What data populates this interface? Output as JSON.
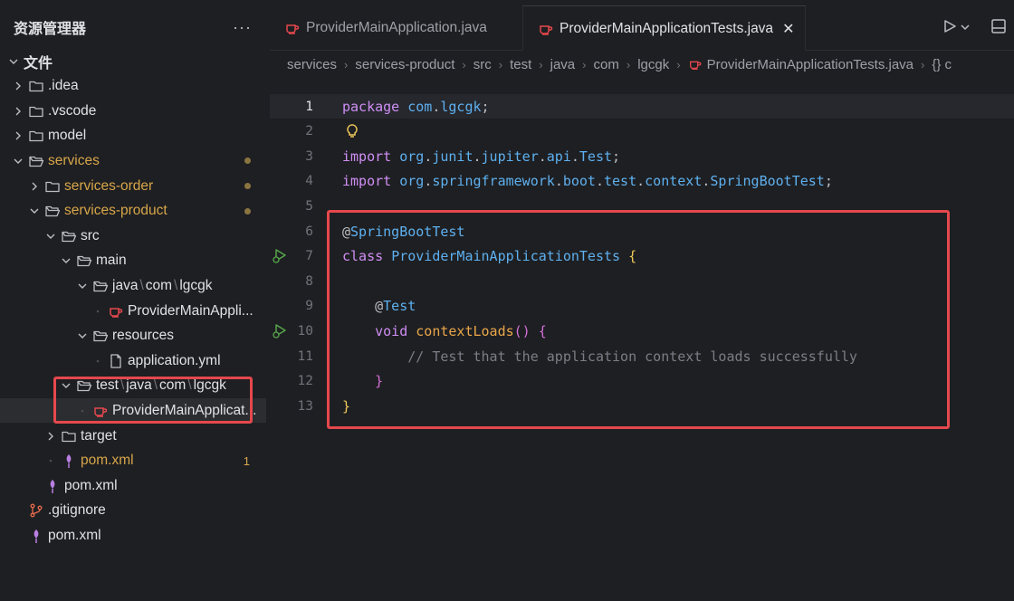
{
  "sidebar": {
    "title": "资源管理器",
    "more_icon": "ellipsis-icon",
    "rows": [
      {
        "label": "文件",
        "depth": 0,
        "kind": "root",
        "open": true
      },
      {
        "label": ".idea",
        "depth": 1,
        "kind": "folder",
        "open": false
      },
      {
        "label": ".vscode",
        "depth": 1,
        "kind": "folder",
        "open": false
      },
      {
        "label": "model",
        "depth": 1,
        "kind": "folder",
        "open": false
      },
      {
        "label": "services",
        "depth": 1,
        "kind": "folder",
        "open": true,
        "modified": true
      },
      {
        "label": "services-order",
        "depth": 2,
        "kind": "folder",
        "open": false,
        "modified": true
      },
      {
        "label": "services-product",
        "depth": 2,
        "kind": "folder",
        "open": true,
        "modified": true
      },
      {
        "label": "src",
        "depth": 3,
        "kind": "folder",
        "open": true
      },
      {
        "label": "main",
        "depth": 4,
        "kind": "folder",
        "open": true
      },
      {
        "label": [
          "java",
          "com",
          "lgcgk"
        ],
        "depth": 5,
        "kind": "folder",
        "open": true
      },
      {
        "label": "ProviderMainAppli...",
        "depth": 6,
        "kind": "java"
      },
      {
        "label": "resources",
        "depth": 5,
        "kind": "folder",
        "open": true
      },
      {
        "label": "application.yml",
        "depth": 6,
        "kind": "file"
      },
      {
        "label": [
          "test",
          "java",
          "com",
          "lgcgk"
        ],
        "depth": 4,
        "kind": "folder",
        "open": true
      },
      {
        "label": "ProviderMainApplicat...",
        "depth": 5,
        "kind": "java",
        "selected": true
      },
      {
        "label": "target",
        "depth": 3,
        "kind": "folder",
        "open": false
      },
      {
        "label": "pom.xml",
        "depth": 3,
        "kind": "maven",
        "modified": true,
        "count": "1"
      },
      {
        "label": "pom.xml",
        "depth": 2,
        "kind": "maven"
      },
      {
        "label": ".gitignore",
        "depth": 1,
        "kind": "git"
      },
      {
        "label": "pom.xml",
        "depth": 1,
        "kind": "maven"
      }
    ]
  },
  "tabs": [
    {
      "label": "ProviderMainApplication.java",
      "active": false
    },
    {
      "label": "ProviderMainApplicationTests.java",
      "active": true
    }
  ],
  "tab_close": "✕",
  "breadcrumb": [
    "services",
    "services-product",
    "src",
    "test",
    "java",
    "com",
    "lgcgk",
    "ProviderMainApplicationTests.java",
    "{} c"
  ],
  "code_lines": [
    {
      "n": "1",
      "tokens": [
        [
          "kw",
          "package"
        ],
        [
          "punc",
          " "
        ],
        [
          "ident",
          "com"
        ],
        [
          "punc",
          "."
        ],
        [
          "ident",
          "lgcgk"
        ],
        [
          "punc",
          ";"
        ]
      ]
    },
    {
      "n": "2",
      "tokens": []
    },
    {
      "n": "3",
      "tokens": [
        [
          "kw",
          "import"
        ],
        [
          "punc",
          " "
        ],
        [
          "ident",
          "org"
        ],
        [
          "punc",
          "."
        ],
        [
          "ident",
          "junit"
        ],
        [
          "punc",
          "."
        ],
        [
          "ident",
          "jupiter"
        ],
        [
          "punc",
          "."
        ],
        [
          "ident",
          "api"
        ],
        [
          "punc",
          "."
        ],
        [
          "cls",
          "Test"
        ],
        [
          "punc",
          ";"
        ]
      ]
    },
    {
      "n": "4",
      "tokens": [
        [
          "kw",
          "import"
        ],
        [
          "punc",
          " "
        ],
        [
          "ident",
          "org"
        ],
        [
          "punc",
          "."
        ],
        [
          "ident",
          "springframework"
        ],
        [
          "punc",
          "."
        ],
        [
          "ident",
          "boot"
        ],
        [
          "punc",
          "."
        ],
        [
          "ident",
          "test"
        ],
        [
          "punc",
          "."
        ],
        [
          "ident",
          "context"
        ],
        [
          "punc",
          "."
        ],
        [
          "cls",
          "SpringBootTest"
        ],
        [
          "punc",
          ";"
        ]
      ]
    },
    {
      "n": "5",
      "tokens": []
    },
    {
      "n": "6",
      "tokens": [
        [
          "punc",
          "@"
        ],
        [
          "ann",
          "SpringBootTest"
        ]
      ]
    },
    {
      "n": "7",
      "tokens": [
        [
          "kw",
          "class"
        ],
        [
          "punc",
          " "
        ],
        [
          "cls",
          "ProviderMainApplicationTests"
        ],
        [
          "punc",
          " "
        ],
        [
          "brace",
          "{"
        ]
      ]
    },
    {
      "n": "8",
      "tokens": []
    },
    {
      "n": "9",
      "tokens": [
        [
          "punc",
          "    @"
        ],
        [
          "ann",
          "Test"
        ]
      ]
    },
    {
      "n": "10",
      "tokens": [
        [
          "punc",
          "    "
        ],
        [
          "kw",
          "void"
        ],
        [
          "punc",
          " "
        ],
        [
          "fn",
          "contextLoads"
        ],
        [
          "brace2",
          "()"
        ],
        [
          "punc",
          " "
        ],
        [
          "brace2",
          "{"
        ]
      ]
    },
    {
      "n": "11",
      "tokens": [
        [
          "punc",
          "        "
        ],
        [
          "comment",
          "// Test that the application context loads successfully"
        ]
      ]
    },
    {
      "n": "12",
      "tokens": [
        [
          "punc",
          "    "
        ],
        [
          "brace2",
          "}"
        ]
      ]
    },
    {
      "n": "13",
      "tokens": [
        [
          "brace",
          "}"
        ]
      ]
    }
  ],
  "colors": {
    "highlight": "#e5484d",
    "modified": "#d8a64a",
    "accent": "#5eb0ef"
  }
}
